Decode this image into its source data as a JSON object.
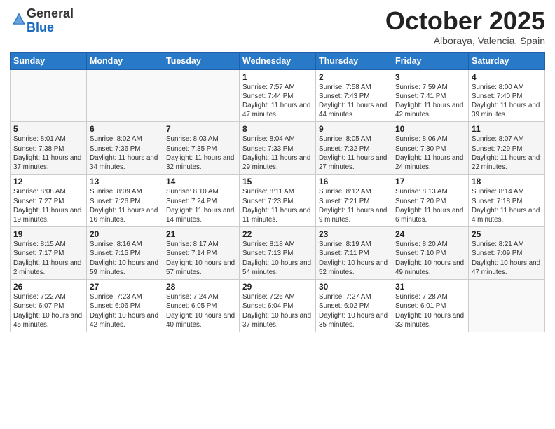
{
  "header": {
    "logo_general": "General",
    "logo_blue": "Blue",
    "month": "October 2025",
    "location": "Alboraya, Valencia, Spain"
  },
  "weekdays": [
    "Sunday",
    "Monday",
    "Tuesday",
    "Wednesday",
    "Thursday",
    "Friday",
    "Saturday"
  ],
  "weeks": [
    [
      {
        "day": "",
        "sunrise": "",
        "sunset": "",
        "daylight": ""
      },
      {
        "day": "",
        "sunrise": "",
        "sunset": "",
        "daylight": ""
      },
      {
        "day": "",
        "sunrise": "",
        "sunset": "",
        "daylight": ""
      },
      {
        "day": "1",
        "sunrise": "Sunrise: 7:57 AM",
        "sunset": "Sunset: 7:44 PM",
        "daylight": "Daylight: 11 hours and 47 minutes."
      },
      {
        "day": "2",
        "sunrise": "Sunrise: 7:58 AM",
        "sunset": "Sunset: 7:43 PM",
        "daylight": "Daylight: 11 hours and 44 minutes."
      },
      {
        "day": "3",
        "sunrise": "Sunrise: 7:59 AM",
        "sunset": "Sunset: 7:41 PM",
        "daylight": "Daylight: 11 hours and 42 minutes."
      },
      {
        "day": "4",
        "sunrise": "Sunrise: 8:00 AM",
        "sunset": "Sunset: 7:40 PM",
        "daylight": "Daylight: 11 hours and 39 minutes."
      }
    ],
    [
      {
        "day": "5",
        "sunrise": "Sunrise: 8:01 AM",
        "sunset": "Sunset: 7:38 PM",
        "daylight": "Daylight: 11 hours and 37 minutes."
      },
      {
        "day": "6",
        "sunrise": "Sunrise: 8:02 AM",
        "sunset": "Sunset: 7:36 PM",
        "daylight": "Daylight: 11 hours and 34 minutes."
      },
      {
        "day": "7",
        "sunrise": "Sunrise: 8:03 AM",
        "sunset": "Sunset: 7:35 PM",
        "daylight": "Daylight: 11 hours and 32 minutes."
      },
      {
        "day": "8",
        "sunrise": "Sunrise: 8:04 AM",
        "sunset": "Sunset: 7:33 PM",
        "daylight": "Daylight: 11 hours and 29 minutes."
      },
      {
        "day": "9",
        "sunrise": "Sunrise: 8:05 AM",
        "sunset": "Sunset: 7:32 PM",
        "daylight": "Daylight: 11 hours and 27 minutes."
      },
      {
        "day": "10",
        "sunrise": "Sunrise: 8:06 AM",
        "sunset": "Sunset: 7:30 PM",
        "daylight": "Daylight: 11 hours and 24 minutes."
      },
      {
        "day": "11",
        "sunrise": "Sunrise: 8:07 AM",
        "sunset": "Sunset: 7:29 PM",
        "daylight": "Daylight: 11 hours and 22 minutes."
      }
    ],
    [
      {
        "day": "12",
        "sunrise": "Sunrise: 8:08 AM",
        "sunset": "Sunset: 7:27 PM",
        "daylight": "Daylight: 11 hours and 19 minutes."
      },
      {
        "day": "13",
        "sunrise": "Sunrise: 8:09 AM",
        "sunset": "Sunset: 7:26 PM",
        "daylight": "Daylight: 11 hours and 16 minutes."
      },
      {
        "day": "14",
        "sunrise": "Sunrise: 8:10 AM",
        "sunset": "Sunset: 7:24 PM",
        "daylight": "Daylight: 11 hours and 14 minutes."
      },
      {
        "day": "15",
        "sunrise": "Sunrise: 8:11 AM",
        "sunset": "Sunset: 7:23 PM",
        "daylight": "Daylight: 11 hours and 11 minutes."
      },
      {
        "day": "16",
        "sunrise": "Sunrise: 8:12 AM",
        "sunset": "Sunset: 7:21 PM",
        "daylight": "Daylight: 11 hours and 9 minutes."
      },
      {
        "day": "17",
        "sunrise": "Sunrise: 8:13 AM",
        "sunset": "Sunset: 7:20 PM",
        "daylight": "Daylight: 11 hours and 6 minutes."
      },
      {
        "day": "18",
        "sunrise": "Sunrise: 8:14 AM",
        "sunset": "Sunset: 7:18 PM",
        "daylight": "Daylight: 11 hours and 4 minutes."
      }
    ],
    [
      {
        "day": "19",
        "sunrise": "Sunrise: 8:15 AM",
        "sunset": "Sunset: 7:17 PM",
        "daylight": "Daylight: 11 hours and 2 minutes."
      },
      {
        "day": "20",
        "sunrise": "Sunrise: 8:16 AM",
        "sunset": "Sunset: 7:15 PM",
        "daylight": "Daylight: 10 hours and 59 minutes."
      },
      {
        "day": "21",
        "sunrise": "Sunrise: 8:17 AM",
        "sunset": "Sunset: 7:14 PM",
        "daylight": "Daylight: 10 hours and 57 minutes."
      },
      {
        "day": "22",
        "sunrise": "Sunrise: 8:18 AM",
        "sunset": "Sunset: 7:13 PM",
        "daylight": "Daylight: 10 hours and 54 minutes."
      },
      {
        "day": "23",
        "sunrise": "Sunrise: 8:19 AM",
        "sunset": "Sunset: 7:11 PM",
        "daylight": "Daylight: 10 hours and 52 minutes."
      },
      {
        "day": "24",
        "sunrise": "Sunrise: 8:20 AM",
        "sunset": "Sunset: 7:10 PM",
        "daylight": "Daylight: 10 hours and 49 minutes."
      },
      {
        "day": "25",
        "sunrise": "Sunrise: 8:21 AM",
        "sunset": "Sunset: 7:09 PM",
        "daylight": "Daylight: 10 hours and 47 minutes."
      }
    ],
    [
      {
        "day": "26",
        "sunrise": "Sunrise: 7:22 AM",
        "sunset": "Sunset: 6:07 PM",
        "daylight": "Daylight: 10 hours and 45 minutes."
      },
      {
        "day": "27",
        "sunrise": "Sunrise: 7:23 AM",
        "sunset": "Sunset: 6:06 PM",
        "daylight": "Daylight: 10 hours and 42 minutes."
      },
      {
        "day": "28",
        "sunrise": "Sunrise: 7:24 AM",
        "sunset": "Sunset: 6:05 PM",
        "daylight": "Daylight: 10 hours and 40 minutes."
      },
      {
        "day": "29",
        "sunrise": "Sunrise: 7:26 AM",
        "sunset": "Sunset: 6:04 PM",
        "daylight": "Daylight: 10 hours and 37 minutes."
      },
      {
        "day": "30",
        "sunrise": "Sunrise: 7:27 AM",
        "sunset": "Sunset: 6:02 PM",
        "daylight": "Daylight: 10 hours and 35 minutes."
      },
      {
        "day": "31",
        "sunrise": "Sunrise: 7:28 AM",
        "sunset": "Sunset: 6:01 PM",
        "daylight": "Daylight: 10 hours and 33 minutes."
      },
      {
        "day": "",
        "sunrise": "",
        "sunset": "",
        "daylight": ""
      }
    ]
  ]
}
